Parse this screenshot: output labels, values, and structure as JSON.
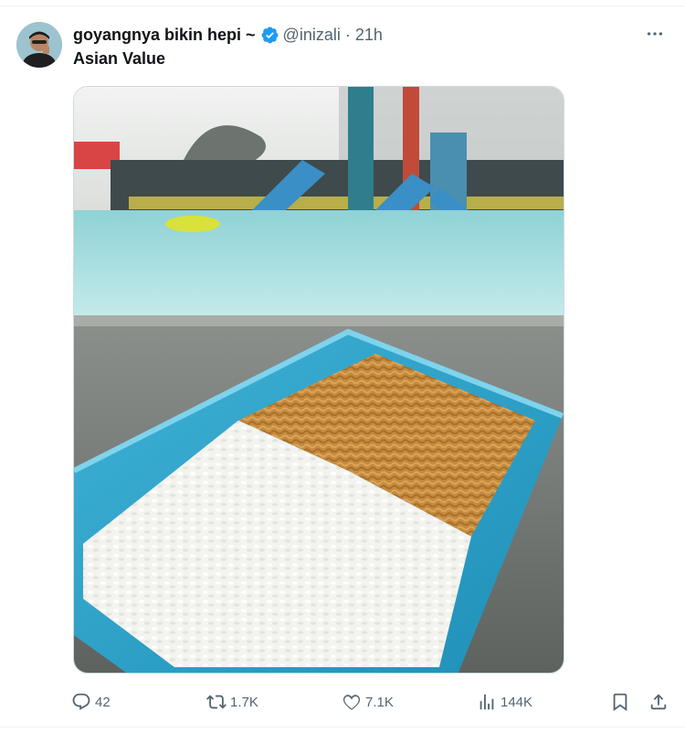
{
  "tweet": {
    "display_name": "goyangnya bikin hepi ~",
    "handle": "@inizali",
    "separator": "·",
    "time": "21h",
    "text": "Asian Value",
    "verified": true
  },
  "actions": {
    "replies": "42",
    "reposts": "1.7K",
    "likes": "7.1K",
    "views": "144K"
  },
  "icons": {
    "more": "more-horizontal-icon",
    "reply": "reply-bubble-icon",
    "repost": "repost-arrows-icon",
    "like": "heart-icon",
    "views": "bar-chart-icon",
    "bookmark": "bookmark-icon",
    "share": "share-upload-icon",
    "verified": "verified-badge-icon"
  },
  "colors": {
    "verified_blue": "#1d9bf0",
    "secondary_text": "#536471",
    "primary_text": "#0f1419"
  }
}
